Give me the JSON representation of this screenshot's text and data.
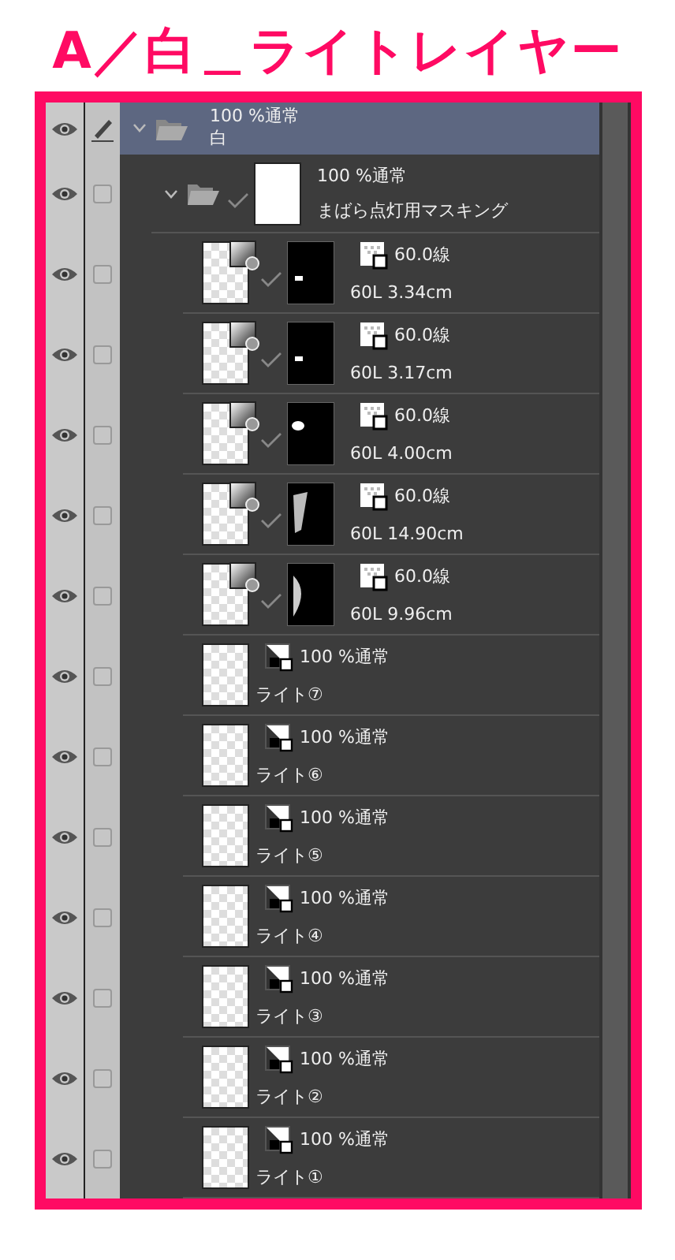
{
  "title": "A／白＿ライトレイヤー",
  "layers": [
    {
      "kind": "folder",
      "info": "100 %通常",
      "name": "白",
      "selected": true,
      "editing": true,
      "expanded": true,
      "children": [
        {
          "kind": "folder",
          "info": "100 %通常",
          "name": "まばら点灯用マスキング",
          "selected": false,
          "editing": false,
          "expanded": true,
          "mask": {
            "kind": "white"
          },
          "children": [
            {
              "kind": "tone",
              "info": "60.0線",
              "name": "60L 3.34cm",
              "selected": false,
              "editing": false,
              "mask": {
                "kind": "tick"
              }
            },
            {
              "kind": "tone",
              "info": "60.0線",
              "name": "60L 3.17cm",
              "selected": false,
              "editing": false,
              "mask": {
                "kind": "tick"
              }
            },
            {
              "kind": "tone",
              "info": "60.0線",
              "name": "60L 4.00cm",
              "selected": false,
              "editing": false,
              "mask": {
                "kind": "dot"
              }
            },
            {
              "kind": "tone",
              "info": "60.0線",
              "name": "60L 14.90cm",
              "selected": false,
              "editing": false,
              "mask": {
                "kind": "wedge"
              }
            },
            {
              "kind": "tone",
              "info": "60.0線",
              "name": "60L 9.96cm",
              "selected": false,
              "editing": false,
              "mask": {
                "kind": "crescent"
              }
            },
            {
              "kind": "raster",
              "info": "100 %通常",
              "name": "ライト⑦",
              "selected": false,
              "editing": false
            },
            {
              "kind": "raster",
              "info": "100 %通常",
              "name": "ライト⑥",
              "selected": false,
              "editing": false
            },
            {
              "kind": "raster",
              "info": "100 %通常",
              "name": "ライト⑤",
              "selected": false,
              "editing": false
            },
            {
              "kind": "raster",
              "info": "100 %通常",
              "name": "ライト④",
              "selected": false,
              "editing": false
            },
            {
              "kind": "raster",
              "info": "100 %通常",
              "name": "ライト③",
              "selected": false,
              "editing": false
            },
            {
              "kind": "raster",
              "info": "100 %通常",
              "name": "ライト②",
              "selected": false,
              "editing": false
            },
            {
              "kind": "raster",
              "info": "100 %通常",
              "name": "ライト①",
              "selected": false,
              "editing": false
            }
          ]
        }
      ]
    }
  ]
}
